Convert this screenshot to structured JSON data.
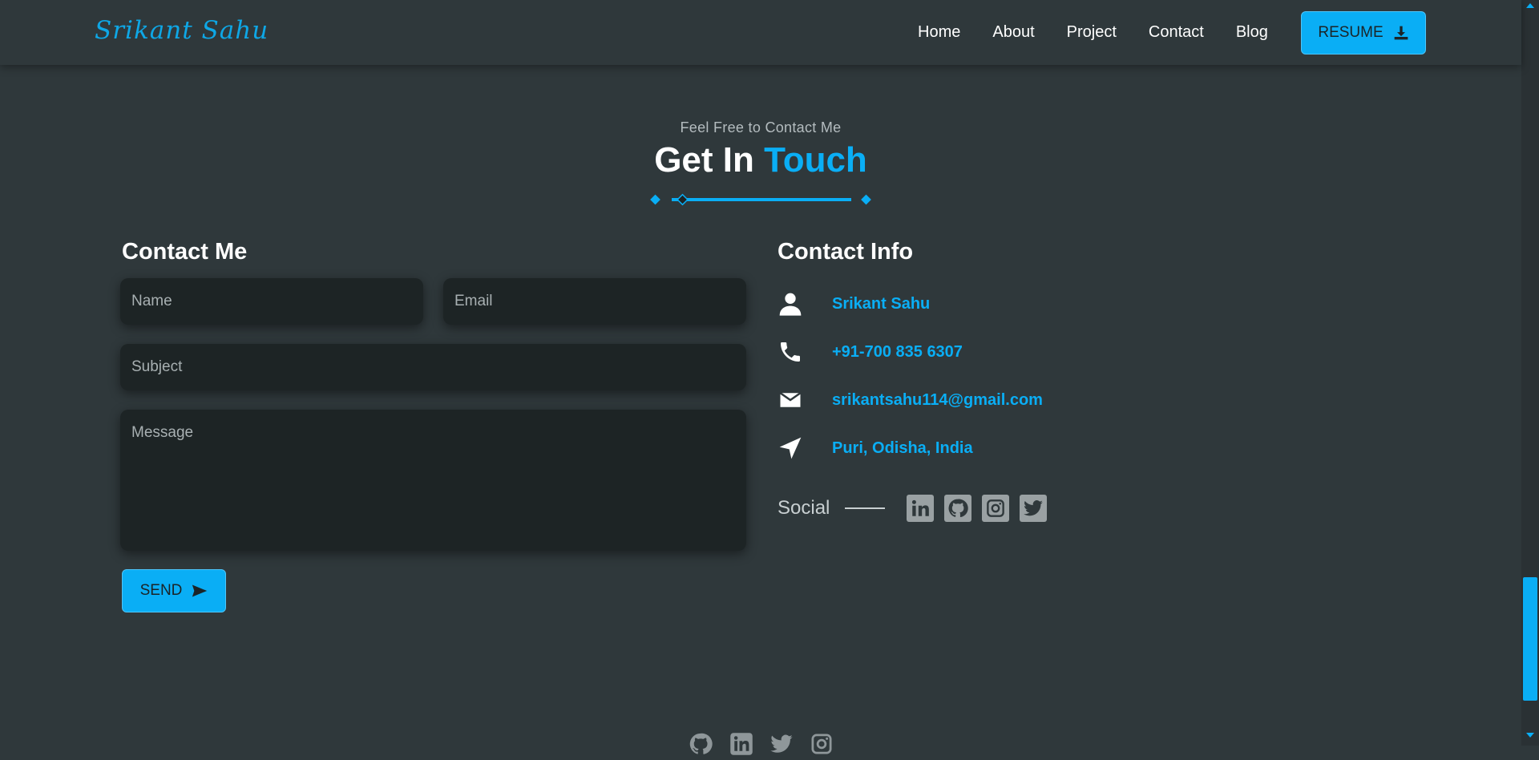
{
  "navbar": {
    "brand": "Srikant Sahu",
    "links": [
      "Home",
      "About",
      "Project",
      "Contact",
      "Blog"
    ],
    "resume_label": "RESUME",
    "resume_icon": "download-icon"
  },
  "section": {
    "subtitle": "Feel Free to Contact Me",
    "title_main": "Get In ",
    "title_accent": "Touch"
  },
  "form": {
    "title": "Contact Me",
    "name_placeholder": "Name",
    "email_placeholder": "Email",
    "subject_placeholder": "Subject",
    "message_placeholder": "Message",
    "send_label": "SEND",
    "send_icon": "send-icon"
  },
  "info": {
    "title": "Contact Info",
    "items": [
      {
        "icon": "user-icon",
        "text": "Srikant Sahu"
      },
      {
        "icon": "phone-icon",
        "text": "+91-700 835 6307"
      },
      {
        "icon": "mail-icon",
        "text": "srikantsahu114@gmail.com"
      },
      {
        "icon": "location-arrow-icon",
        "text": "Puri, Odisha, India"
      }
    ],
    "social_label": "Social",
    "social_icons": [
      "linkedin-icon",
      "github-icon",
      "instagram-icon",
      "twitter-icon"
    ]
  },
  "footer": {
    "social_icons": [
      "github-icon",
      "linkedin-icon",
      "twitter-icon",
      "instagram-icon"
    ]
  },
  "colors": {
    "background": "#2f383b",
    "accent": "#0aaef5",
    "field_bg": "#1d2425"
  }
}
